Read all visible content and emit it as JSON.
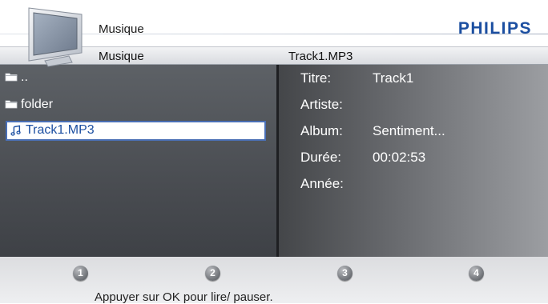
{
  "header": {
    "title": "Musique",
    "brand": "PHILIPS",
    "icon": "tv-icon"
  },
  "breadcrumb": {
    "left": "Musique",
    "right": "Track1.MP3"
  },
  "browser": {
    "items": [
      {
        "label": "..",
        "icon": "folder-icon",
        "selected": false
      },
      {
        "label": "folder",
        "icon": "folder-icon",
        "selected": false
      },
      {
        "label": "Track1.MP3",
        "icon": "music-note-icon",
        "selected": true
      }
    ]
  },
  "info": {
    "rows": [
      {
        "key": "Titre:",
        "value": "Track1"
      },
      {
        "key": "Artiste:",
        "value": ""
      },
      {
        "key": "Album:",
        "value": "Sentiment..."
      },
      {
        "key": "Durée:",
        "value": "00:02:53"
      },
      {
        "key": "Année:",
        "value": ""
      }
    ]
  },
  "footer": {
    "buttons": [
      "1",
      "2",
      "3",
      "4"
    ],
    "hint": "Appuyer sur OK pour lire/ pauser."
  },
  "colors": {
    "brand": "#1c4fa1",
    "selection_border": "#4a6fb5"
  }
}
